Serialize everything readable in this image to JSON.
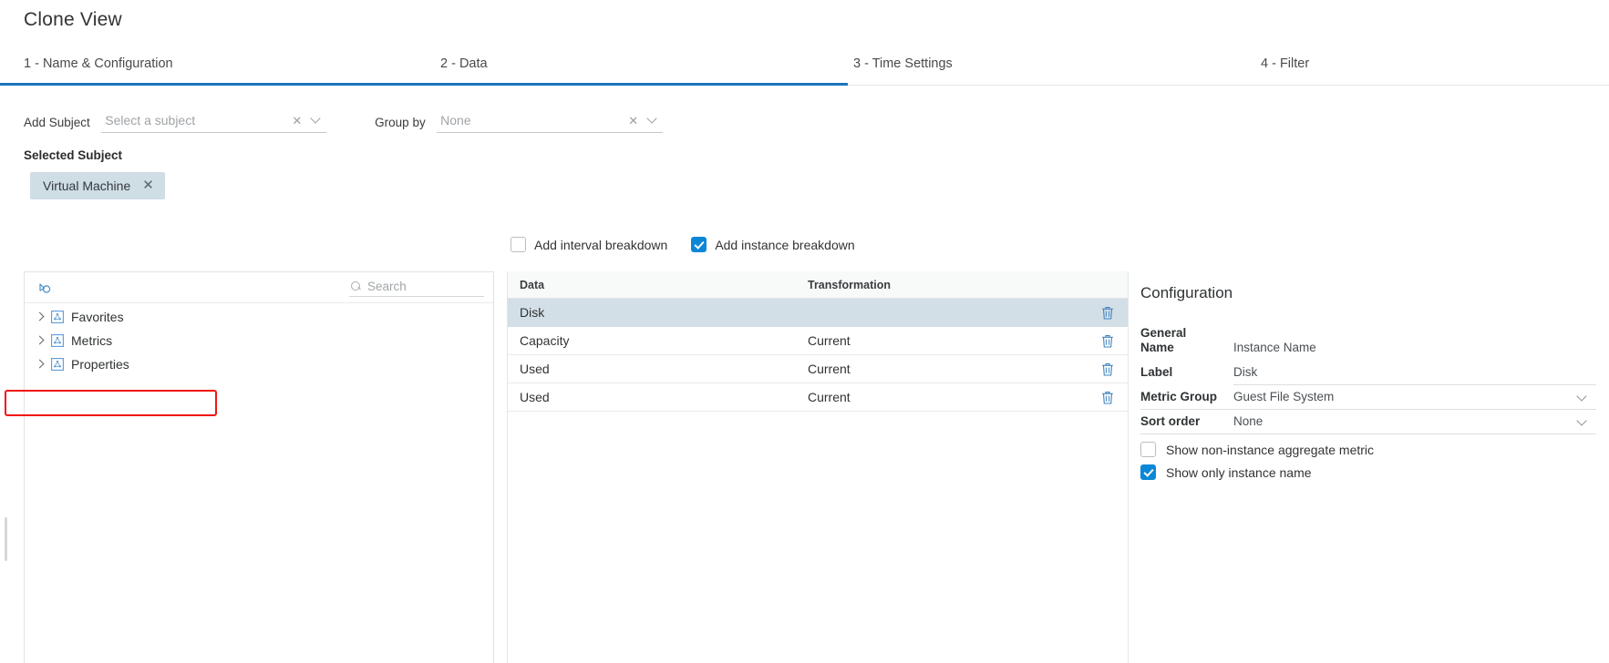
{
  "header": {
    "title": "Clone View"
  },
  "tabs": [
    {
      "label": "1 - Name & Configuration",
      "active": true
    },
    {
      "label": "2 - Data",
      "active": true
    },
    {
      "label": "3 - Time Settings",
      "active": false
    },
    {
      "label": "4 - Filter",
      "active": false
    }
  ],
  "subject_row": {
    "add_subject_label": "Add Subject",
    "add_subject_value": "Select a subject",
    "group_by_label": "Group by",
    "group_by_value": "None",
    "clear_icon": "clear-x-icon",
    "chevron_icon": "chevron-down-icon"
  },
  "selected_subject": {
    "heading": "Selected Subject",
    "chips": [
      {
        "label": "Virtual Machine",
        "remove_icon": "close-x-icon"
      }
    ]
  },
  "breakdowns": [
    {
      "label": "Add interval breakdown",
      "checked": false
    },
    {
      "label": "Add instance breakdown",
      "checked": true
    }
  ],
  "tree_panel": {
    "toolbar_icon": "object-picker-icon",
    "search_placeholder": "Search",
    "search_icon": "search-icon",
    "items": [
      {
        "label": "Favorites",
        "icon": "metric-group-icon",
        "expanded": false
      },
      {
        "label": "Metrics",
        "icon": "metric-group-icon",
        "expanded": false
      },
      {
        "label": "Properties",
        "icon": "metric-group-icon",
        "expanded": false
      }
    ]
  },
  "data_table": {
    "columns": [
      "Data",
      "Transformation"
    ],
    "rows": [
      {
        "data": "Disk",
        "transformation": "",
        "selected": true,
        "delete_icon": "trash-icon"
      },
      {
        "data": "Capacity",
        "transformation": "Current",
        "selected": false,
        "delete_icon": "trash-icon"
      },
      {
        "data": "Used",
        "transformation": "Current",
        "selected": false,
        "delete_icon": "trash-icon"
      },
      {
        "data": "Used",
        "transformation": "Current",
        "selected": false,
        "delete_icon": "trash-icon"
      }
    ]
  },
  "configuration": {
    "title": "Configuration",
    "section": "General",
    "fields": [
      {
        "key": "Name",
        "value": "Instance Name",
        "type": "text"
      },
      {
        "key": "Label",
        "value": "Disk",
        "type": "text",
        "highlighted": true
      },
      {
        "key": "Metric Group",
        "value": "Guest File System",
        "type": "select"
      },
      {
        "key": "Sort order",
        "value": "None",
        "type": "select"
      }
    ],
    "checkboxes": [
      {
        "label": "Show non-instance aggregate metric",
        "checked": false
      },
      {
        "label": "Show only instance name",
        "checked": true
      }
    ]
  },
  "colors": {
    "accent_blue": "#1b75bb",
    "checkbox_blue": "#0c87d8",
    "chip_bg": "#cfdde5",
    "row_selected": "#d3dfe6",
    "highlight_red": "#f21410"
  }
}
